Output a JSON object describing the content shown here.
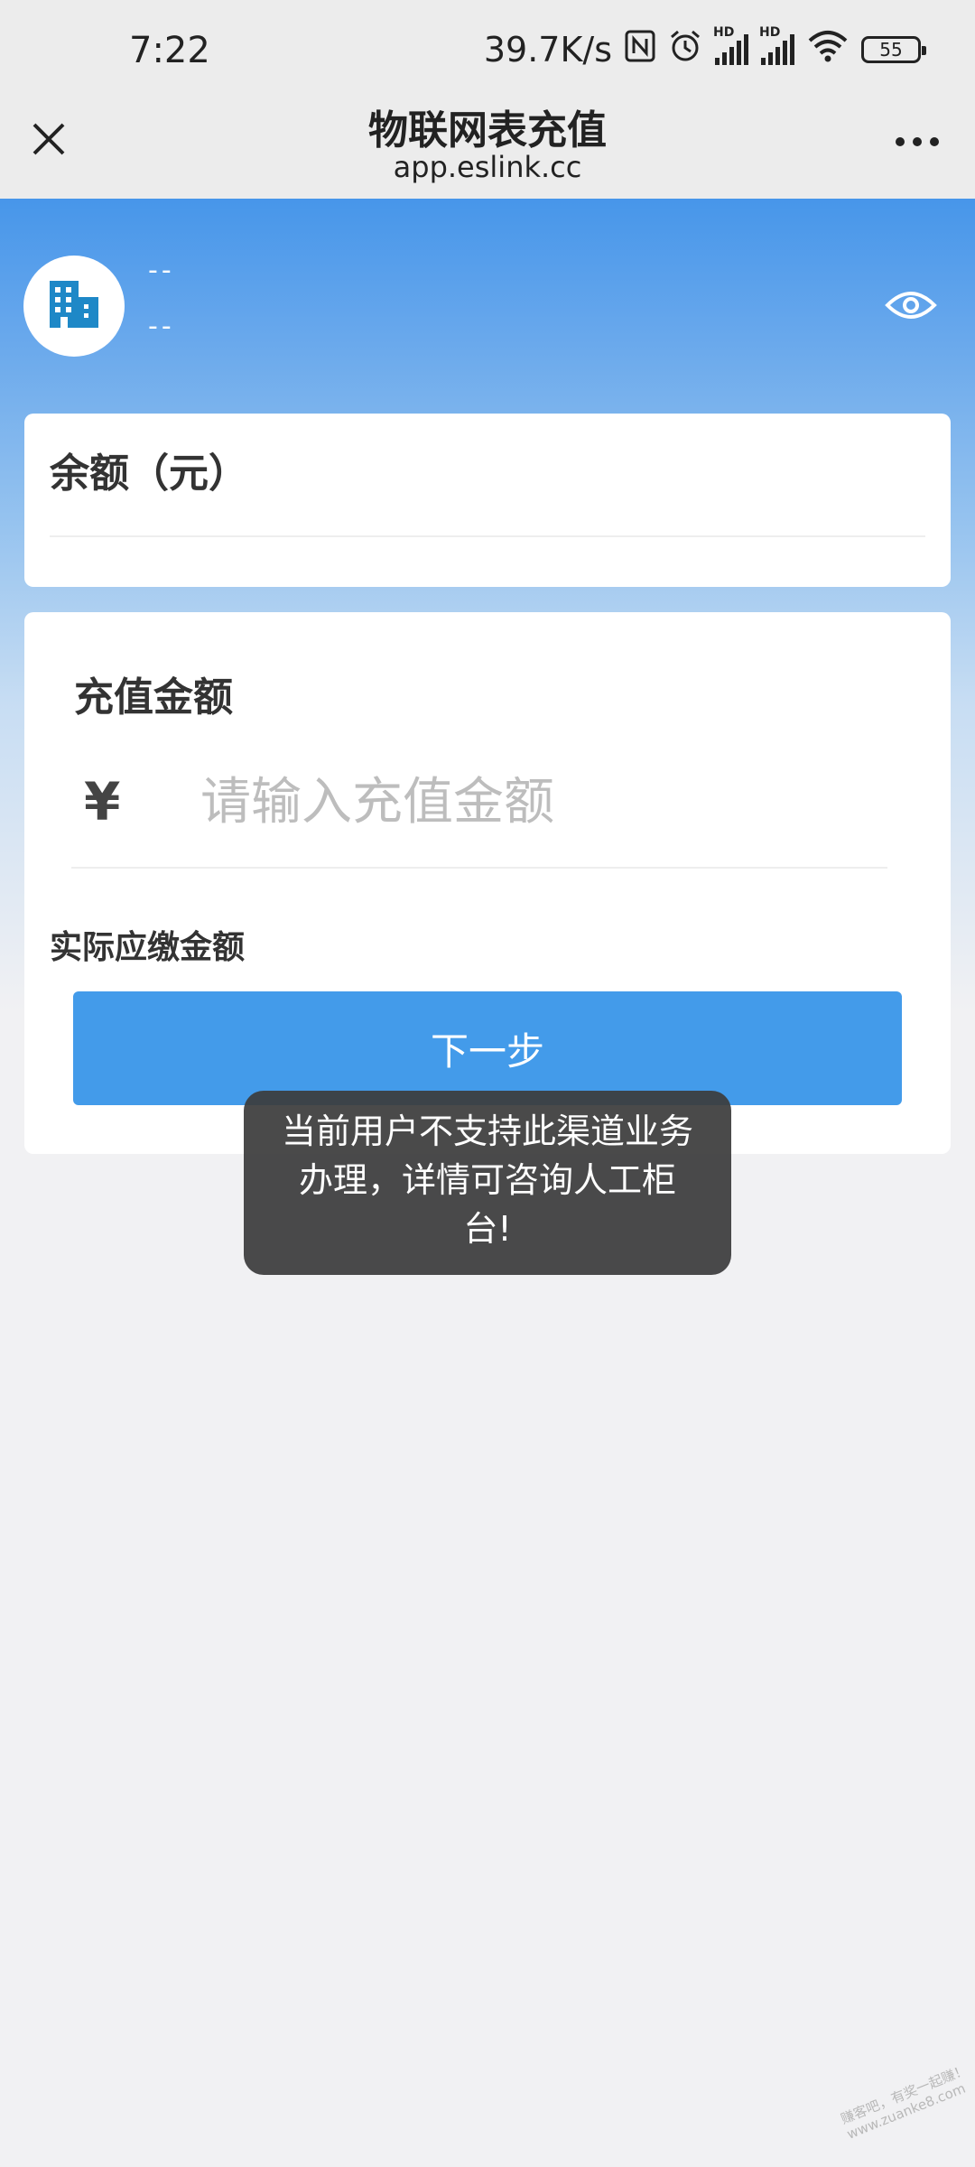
{
  "status_bar": {
    "time": "7:22",
    "net_speed": "39.7K/s",
    "battery": "55",
    "hd_label": "HD"
  },
  "nav": {
    "title": "物联网表充值",
    "subtitle": "app.eslink.cc"
  },
  "user": {
    "name": "--",
    "account": "--"
  },
  "balance": {
    "label": "余额（元）"
  },
  "recharge": {
    "label": "充值金额",
    "currency_symbol": "¥",
    "input_value": "",
    "input_placeholder": "请输入充值金额",
    "actual_label": "实际应缴金额",
    "next_button": "下一步"
  },
  "toast": {
    "message": "当前用户不支持此渠道业务办理，详情可咨询人工柜台!"
  },
  "watermark": {
    "line1": "赚客吧，有奖一起赚！",
    "line2": "www.zuanke8.com"
  },
  "colors": {
    "primary": "#439bea",
    "header_gradient_top": "#4796ea",
    "page_bg": "#f1f1f3",
    "toast_bg": "#3c3c3c"
  }
}
